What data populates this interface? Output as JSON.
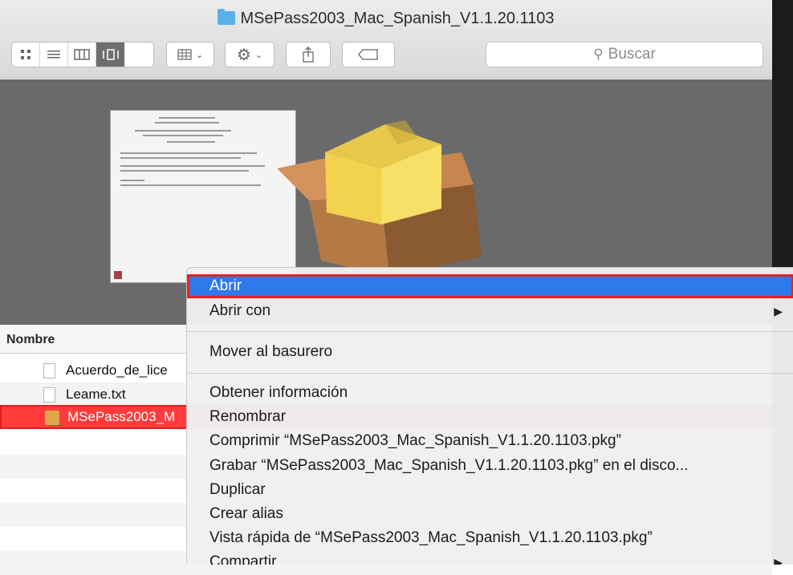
{
  "window": {
    "title": "MSePass2003_Mac_Spanish_V1.1.20.1103"
  },
  "toolbar": {
    "view_buttons": [
      "icon-view",
      "list-view",
      "column-view",
      "cover-flow-view"
    ],
    "search_placeholder": "Buscar"
  },
  "list": {
    "column_header": "Nombre",
    "files": [
      {
        "name": "Acuerdo_de_lice",
        "icon": "document-icon"
      },
      {
        "name": "Leame.txt",
        "icon": "text-file-icon"
      },
      {
        "name": "MSePass2003_M",
        "icon": "package-icon",
        "selected": true
      }
    ]
  },
  "context_menu": {
    "items": [
      {
        "label": "Abrir",
        "highlighted": true
      },
      {
        "label": "Abrir con",
        "submenu": true
      },
      {
        "label": "Mover al basurero"
      },
      {
        "label": "Obtener información"
      },
      {
        "label": "Renombrar"
      },
      {
        "label": "Comprimir “MSePass2003_Mac_Spanish_V1.1.20.1103.pkg”"
      },
      {
        "label": "Grabar “MSePass2003_Mac_Spanish_V1.1.20.1103.pkg” en el disco..."
      },
      {
        "label": "Duplicar"
      },
      {
        "label": "Crear alias"
      },
      {
        "label": "Vista rápida de “MSePass2003_Mac_Spanish_V1.1.20.1103.pkg”"
      },
      {
        "label": "Compartir",
        "submenu": true
      }
    ]
  },
  "colors": {
    "highlight": "#2f79ea",
    "selection_row": "#ff3b3b",
    "annotation_border": "#e52121"
  }
}
